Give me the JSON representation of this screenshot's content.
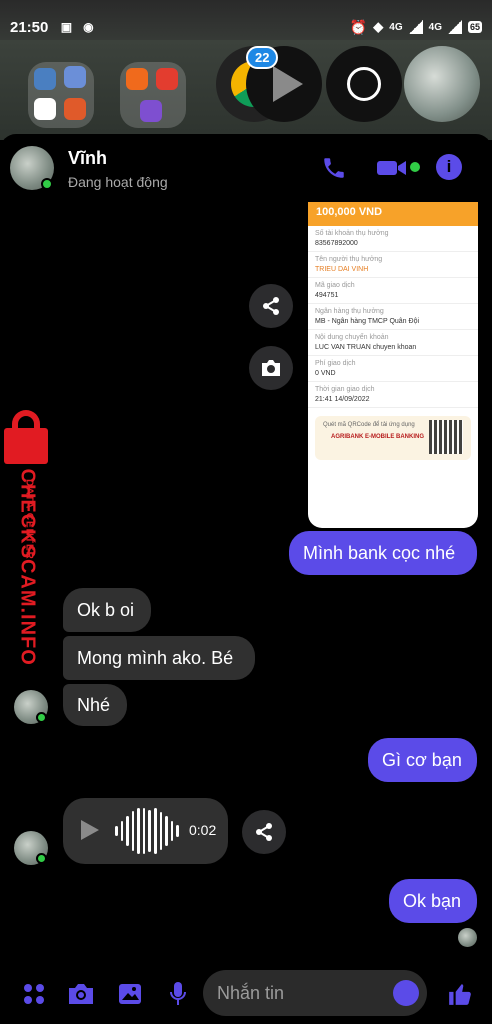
{
  "status_bar": {
    "time": "21:50",
    "net1": "4G",
    "net2": "4G",
    "battery": "65"
  },
  "home": {
    "badge_count": "22"
  },
  "header": {
    "name": "Vĩnh",
    "status": "Đang hoạt động"
  },
  "receipt": {
    "amount": "100,000 VND",
    "rows": [
      {
        "label": "Số tài khoản thụ hưởng",
        "value": "83567892000",
        "accent": false
      },
      {
        "label": "Tên người thụ hưởng",
        "value": "TRIEU DAI VINH",
        "accent": true
      },
      {
        "label": "Mã giao dịch",
        "value": "494751",
        "accent": false
      },
      {
        "label": "Ngân hàng thụ hưởng",
        "value": "MB - Ngân hàng TMCP Quân Đội",
        "accent": false
      },
      {
        "label": "Nội dung chuyển khoản",
        "value": "LUC VAN TRUAN chuyen khoan",
        "accent": false
      },
      {
        "label": "Phí giao dịch",
        "value": "0 VND",
        "accent": false
      },
      {
        "label": "Thời gian giao dịch",
        "value": "21:41 14/09/2022",
        "accent": false
      }
    ],
    "qr_text": "Quét mã QRCode để tải ứng dụng",
    "bank_logo": "AGRIBANK E-MOBILE BANKING"
  },
  "messages": {
    "m1": "Mình bank cọc nhé",
    "m2": "Ok b oi",
    "m3": "Mong mình ako. Bé",
    "m4": "Nhé",
    "m5": "Gì cơ bạn",
    "voice_duration": "0:02",
    "m6": "Ok bạn"
  },
  "watermark": {
    "line1": "DATA CENTER",
    "line2": "CHECKSCAM.INFO"
  },
  "composer": {
    "placeholder": "Nhắn tin"
  },
  "colors": {
    "accent": "#5b4be8",
    "incoming": "#303030",
    "online": "#31cc46",
    "watermark": "#e11b22"
  }
}
